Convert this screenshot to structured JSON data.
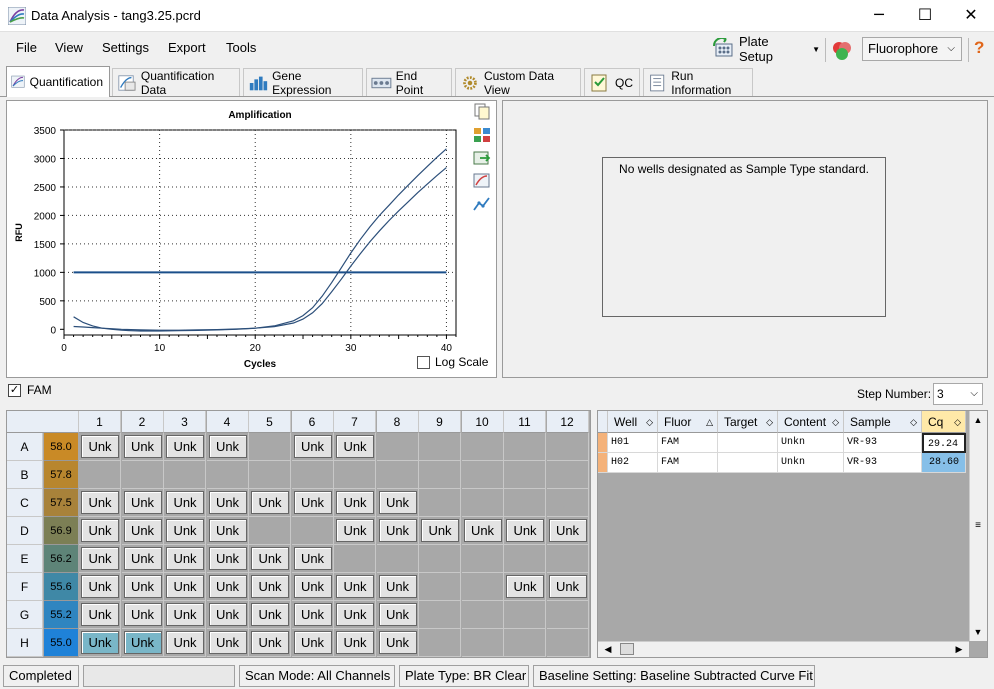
{
  "window": {
    "title": "Data Analysis - tang3.25.pcrd",
    "minimize": "─",
    "maximize": "☐",
    "close": "✕"
  },
  "menu": [
    "File",
    "View",
    "Settings",
    "Export",
    "Tools"
  ],
  "toolbar": {
    "plate_setup": "Plate Setup",
    "fluorophore_select": "Fluorophore",
    "help": "?"
  },
  "tabs": [
    "Quantification",
    "Quantification Data",
    "Gene Expression",
    "End Point",
    "Custom Data View",
    "QC",
    "Run Information"
  ],
  "chart_panel": {
    "log_scale_label": "Log Scale"
  },
  "chart_data": {
    "type": "line",
    "title": "Amplification",
    "xlabel": "Cycles",
    "ylabel": "RFU",
    "xlim": [
      0,
      41
    ],
    "ylim": [
      -100,
      3500
    ],
    "xticks": [
      0,
      10,
      20,
      30,
      40
    ],
    "yticks": [
      0,
      500,
      1000,
      1500,
      2000,
      2500,
      3000,
      3500
    ],
    "grid": true,
    "threshold": 1000,
    "series": [
      {
        "x": [
          1,
          2,
          3,
          4,
          5,
          6,
          7,
          8,
          10,
          12,
          14,
          16,
          18,
          20,
          22,
          24,
          25,
          26,
          27,
          28,
          29,
          30,
          31,
          32,
          33,
          34,
          35,
          36,
          37,
          38,
          39,
          40
        ],
        "values": [
          220,
          120,
          60,
          20,
          0,
          -15,
          -25,
          -30,
          -30,
          -25,
          -20,
          -10,
          0,
          20,
          60,
          150,
          240,
          380,
          580,
          820,
          1080,
          1340,
          1580,
          1800,
          2000,
          2180,
          2360,
          2530,
          2700,
          2860,
          3020,
          3170
        ]
      },
      {
        "x": [
          1,
          2,
          3,
          4,
          5,
          6,
          7,
          8,
          10,
          12,
          14,
          16,
          18,
          20,
          22,
          24,
          25,
          26,
          27,
          28,
          29,
          30,
          31,
          32,
          33,
          34,
          35,
          36,
          37,
          38,
          39,
          40
        ],
        "values": [
          50,
          40,
          30,
          20,
          10,
          0,
          -5,
          -10,
          -15,
          -15,
          -10,
          -5,
          5,
          20,
          45,
          110,
          180,
          290,
          450,
          660,
          880,
          1110,
          1330,
          1540,
          1730,
          1910,
          2080,
          2240,
          2400,
          2550,
          2700,
          2840
        ]
      }
    ]
  },
  "standard_panel": {
    "message": "No wells designated as Sample Type standard."
  },
  "fam": {
    "label": "FAM",
    "checked": true
  },
  "step_number": {
    "label": "Step Number:",
    "value": "3"
  },
  "plate": {
    "columns": [
      "1",
      "2",
      "3",
      "4",
      "5",
      "6",
      "7",
      "8",
      "9",
      "10",
      "11",
      "12"
    ],
    "rows": [
      {
        "letter": "A",
        "temp": "58.0",
        "temp_color": "#c98a26",
        "wells": [
          "Unk",
          "Unk",
          "Unk",
          "Unk",
          "",
          "Unk",
          "Unk",
          "",
          "",
          "",
          "",
          ""
        ]
      },
      {
        "letter": "B",
        "temp": "57.8",
        "temp_color": "#b8862e",
        "wells": [
          "",
          "",
          "",
          "",
          "",
          "",
          "",
          "",
          "",
          "",
          "",
          ""
        ]
      },
      {
        "letter": "C",
        "temp": "57.5",
        "temp_color": "#a8823a",
        "wells": [
          "Unk",
          "Unk",
          "Unk",
          "Unk",
          "Unk",
          "Unk",
          "Unk",
          "Unk",
          "",
          "",
          "",
          ""
        ]
      },
      {
        "letter": "D",
        "temp": "56.9",
        "temp_color": "#7c7f55",
        "wells": [
          "Unk",
          "Unk",
          "Unk",
          "Unk",
          "",
          "",
          "Unk",
          "Unk",
          "Unk",
          "Unk",
          "Unk",
          "Unk"
        ]
      },
      {
        "letter": "E",
        "temp": "56.2",
        "temp_color": "#5e8478",
        "wells": [
          "Unk",
          "Unk",
          "Unk",
          "Unk",
          "Unk",
          "Unk",
          "",
          "",
          "",
          "",
          "",
          ""
        ]
      },
      {
        "letter": "F",
        "temp": "55.6",
        "temp_color": "#3f88a6",
        "wells": [
          "Unk",
          "Unk",
          "Unk",
          "Unk",
          "Unk",
          "Unk",
          "Unk",
          "Unk",
          "",
          "",
          "Unk",
          "Unk"
        ]
      },
      {
        "letter": "G",
        "temp": "55.2",
        "temp_color": "#2f85c0",
        "wells": [
          "Unk",
          "Unk",
          "Unk",
          "Unk",
          "Unk",
          "Unk",
          "Unk",
          "Unk",
          "",
          "",
          "",
          ""
        ]
      },
      {
        "letter": "H",
        "temp": "55.0",
        "temp_color": "#1f82d8",
        "wells": [
          "Unk",
          "Unk",
          "Unk",
          "Unk",
          "Unk",
          "Unk",
          "Unk",
          "Unk",
          "",
          "",
          "",
          ""
        ],
        "highlight": [
          0,
          1
        ]
      }
    ]
  },
  "results_grid": {
    "headers": [
      "Well",
      "Fluor",
      "Target",
      "Content",
      "Sample",
      "Cq"
    ],
    "rows": [
      [
        "H01",
        "FAM",
        "",
        "Unkn",
        "VR-93",
        "29.24"
      ],
      [
        "H02",
        "FAM",
        "",
        "Unkn",
        "VR-93",
        "28.60"
      ]
    ]
  },
  "status_bar": {
    "state": "Completed",
    "scan_mode": "Scan Mode: All Channels",
    "plate_type": "Plate Type: BR Clear",
    "baseline": "Baseline Setting: Baseline Subtracted Curve Fit"
  }
}
